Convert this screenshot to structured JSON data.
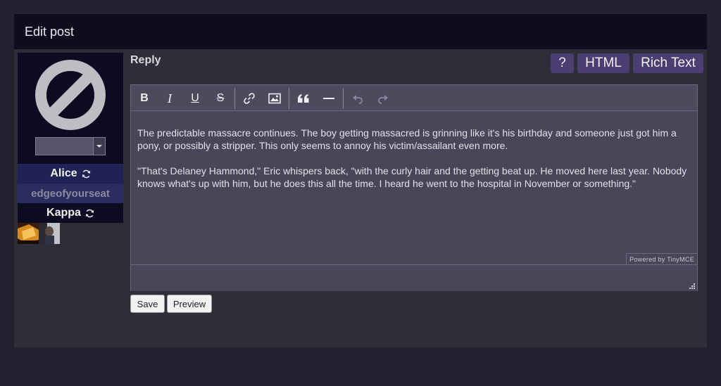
{
  "panel": {
    "title": "Edit post"
  },
  "sidebar": {
    "avatar_icon": "no-entry-icon",
    "character_select": {
      "value": ""
    },
    "alias": "Alice",
    "username": "edgeofyourseat",
    "character": "Kappa",
    "swap_icon": "refresh-icon"
  },
  "editor": {
    "label": "Reply",
    "modes": {
      "help": "?",
      "html": "HTML",
      "rich": "Rich Text"
    },
    "toolbar": [
      {
        "name": "bold-icon",
        "glyph": "B"
      },
      {
        "name": "italic-icon",
        "glyph": "I"
      },
      {
        "name": "underline-icon",
        "glyph": "U"
      },
      {
        "name": "strikethrough-icon",
        "glyph": "S"
      },
      {
        "name": "link-icon"
      },
      {
        "name": "image-icon"
      },
      {
        "name": "blockquote-icon"
      },
      {
        "name": "horizontal-rule-icon"
      },
      {
        "name": "undo-icon"
      },
      {
        "name": "redo-icon"
      }
    ],
    "paragraphs": [
      "The predictable massacre continues. The boy getting massacred is grinning like it's his birthday and someone just got him a pony, or possibly a stripper. This only seems to annoy his victim/assailant even more.",
      "\"That's Delaney Hammond,\" Eric whispers back, \"with the curly hair and the getting beat up. He moved here last year. Nobody knows what's up with him, but he does this all the time. I heard he went to the hospital in November or something.\""
    ],
    "powered_by": "Powered by TinyMCE"
  },
  "actions": {
    "save": "Save",
    "preview": "Preview"
  },
  "colors": {
    "accent": "#4a3e72",
    "page_bg": "#23212f",
    "header_bg": "#0e0c1f"
  }
}
